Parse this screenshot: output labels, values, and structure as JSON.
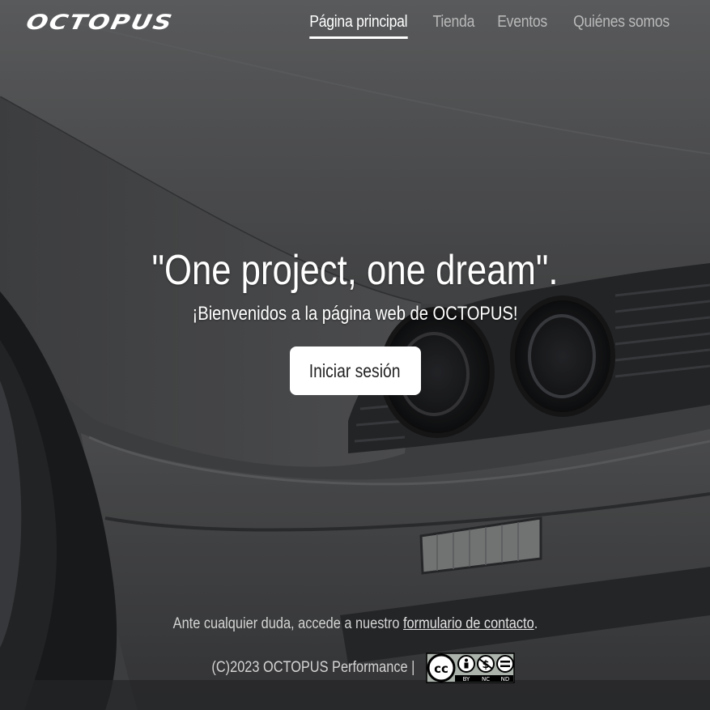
{
  "brand": {
    "logo_text": "OCTOPUS"
  },
  "nav": {
    "items": [
      {
        "label": "Página principal",
        "active": true
      },
      {
        "label": "Tienda",
        "active": false
      },
      {
        "label": "Eventos",
        "active": false
      },
      {
        "label": "Quiénes somos",
        "active": false
      }
    ]
  },
  "hero": {
    "title": "\"One project, one dream\".",
    "subtitle": "¡Bienvenidos a la página web de OCTOPUS!",
    "login_label": "Iniciar sesión"
  },
  "footer": {
    "contact_prefix": "Ante cualquier duda, accede a nuestro ",
    "contact_link": "formulario de contacto",
    "contact_suffix": ".",
    "copyright": "(C)2023 OCTOPUS Performance |",
    "license_labels": [
      "BY",
      "NC",
      "ND"
    ]
  },
  "colors": {
    "text": "#ffffff",
    "nav_inactive": "#b9b9b9",
    "button_bg": "#ffffff",
    "button_text": "#222222"
  },
  "icons": {
    "license_badge": "creative-commons-by-nc-nd-icon",
    "background": "car-front-photo"
  }
}
